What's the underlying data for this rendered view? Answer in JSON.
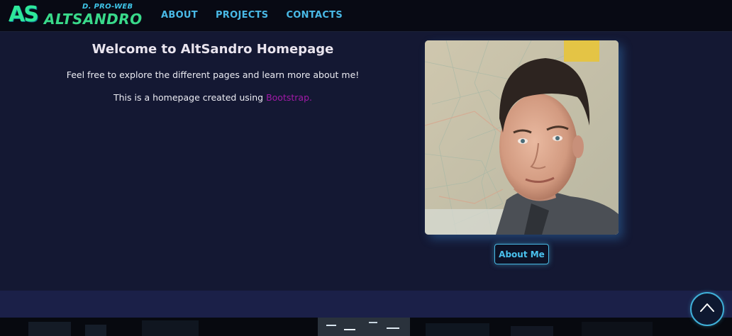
{
  "brand": {
    "mark": "AS",
    "tagline": "D. PRO-WEB",
    "name": "ALTSANDRO"
  },
  "nav": {
    "items": [
      {
        "label": "ABOUT"
      },
      {
        "label": "PROJECTS"
      },
      {
        "label": "CONTACTS"
      }
    ]
  },
  "hero": {
    "title": "Welcome to AltSandro Homepage",
    "intro": "Feel free to explore the different pages and learn more about me!",
    "built_prefix": "This is a homepage created using ",
    "built_link": "Bootstrap."
  },
  "about_button": {
    "label": "About Me"
  },
  "icons": {
    "scroll_top": "chevron-up-icon",
    "logo": "altsandro-logo"
  },
  "colors": {
    "accent": "#49b9e6",
    "link": "#a21aa8",
    "background": "#141833",
    "navbar": "#080a14"
  }
}
